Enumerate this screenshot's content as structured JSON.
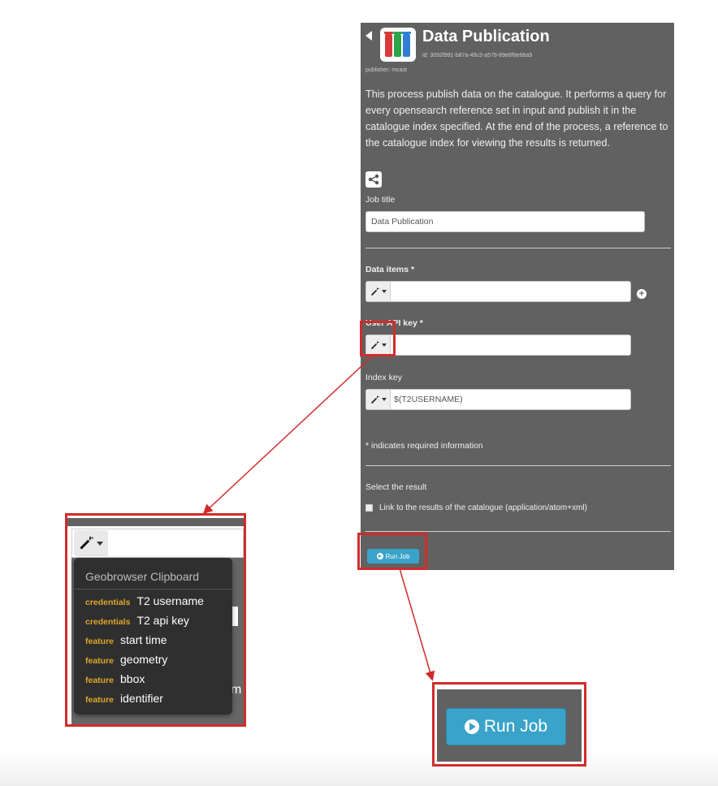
{
  "panel": {
    "title": "Data Publication",
    "process_id": "id: 3092f991-b87a-49c3-a578-89e6f8e66a9",
    "publisher": "publisher: mcast",
    "description": "This process publish data on the catalogue. It performs a query for every opensearch reference set in input and publish it in the catalogue index specified. At the end of the process, a reference to the catalogue index for viewing the results is returned.",
    "job_title_label": "Job title",
    "job_title_value": "Data Publication",
    "data_items_label": "Data items *",
    "data_items_value": "",
    "api_key_label": "User API key *",
    "api_key_value": "",
    "index_key_label": "Index key",
    "index_key_value": "$(T2USERNAME)",
    "required_note": "* indicates required information",
    "select_result_label": "Select the result",
    "result_option_label": "Link to the results of the catalogue (application/atom+xml)",
    "run_button_label": "Run Job"
  },
  "clipboard": {
    "header": "Geobrowser Clipboard",
    "items": [
      {
        "tag": "credentials",
        "label": "T2 username"
      },
      {
        "tag": "credentials",
        "label": "T2 api key"
      },
      {
        "tag": "feature",
        "label": "start time"
      },
      {
        "tag": "feature",
        "label": "geometry"
      },
      {
        "tag": "feature",
        "label": "bbox"
      },
      {
        "tag": "feature",
        "label": "identifier"
      }
    ],
    "bg_fragment_b": ")",
    "bg_fragment_m": "m"
  },
  "zoom_run": {
    "label": "Run Job"
  },
  "colors": {
    "panel_bg": "#616161",
    "highlight": "#d22b2b",
    "button_blue": "#3aa3c9",
    "tag_orange": "#e0a52a",
    "dropdown_bg": "#2f2f2f"
  },
  "icons": {
    "back": "chevron-left-icon",
    "logo": "recycle-bins-logo-icon",
    "share": "share-icon",
    "wand": "magic-wand-icon",
    "caret": "caret-down-icon",
    "add": "plus-circle-icon",
    "play": "play-circle-icon"
  }
}
